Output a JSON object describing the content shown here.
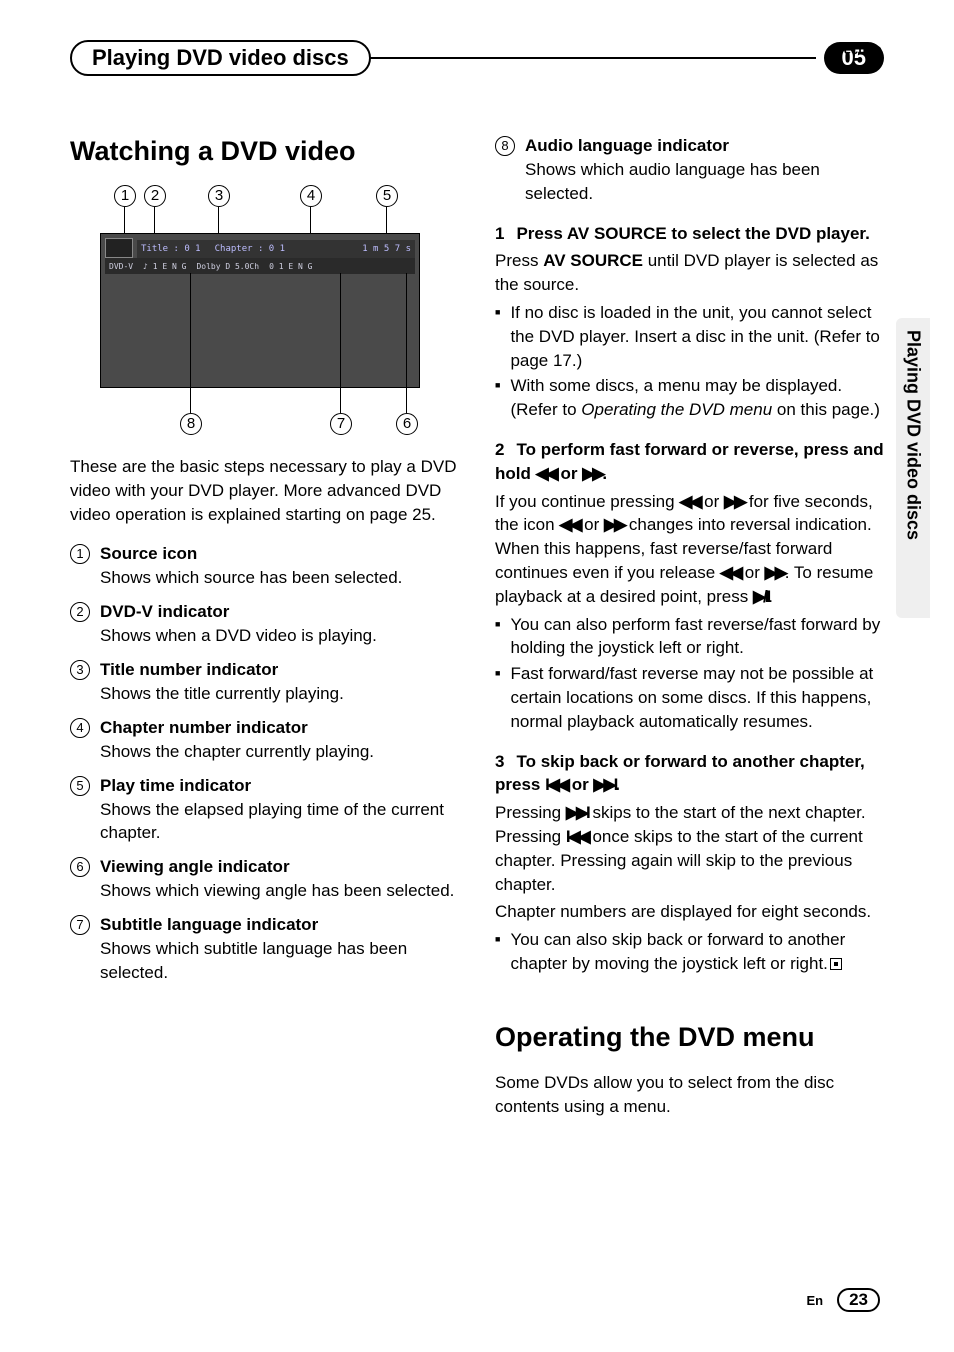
{
  "header": {
    "section_label": "Section",
    "chapter_title": "Playing DVD video discs",
    "chapter_number": "05",
    "side_tab": "Playing DVD video discs"
  },
  "left": {
    "heading": "Watching a DVD video",
    "diagram": {
      "top": [
        "1",
        "2",
        "3",
        "4",
        "5"
      ],
      "bottom": [
        "8",
        "7",
        "6"
      ],
      "bar1": {
        "title": "Title : 0 1",
        "chapter": "Chapter : 0 1",
        "time": "1 m 5 7 s"
      },
      "bar2": {
        "src": "DVD-V",
        "dig": "♪ 1 E N G",
        "dolby": "Dolby D 5.0Ch",
        "ang": "0 1 E N G"
      }
    },
    "intro": "These are the basic steps necessary to play a DVD video with your DVD player. More advanced DVD video operation is explained starting on page 25.",
    "items": [
      {
        "n": "1",
        "title": "Source icon",
        "desc": "Shows which source has been selected."
      },
      {
        "n": "2",
        "title": "DVD-V indicator",
        "desc": "Shows when a DVD video is playing."
      },
      {
        "n": "3",
        "title": "Title number indicator",
        "desc": "Shows the title currently playing."
      },
      {
        "n": "4",
        "title": "Chapter number indicator",
        "desc": "Shows the chapter currently playing."
      },
      {
        "n": "5",
        "title": "Play time indicator",
        "desc": "Shows the elapsed playing time of the current chapter."
      },
      {
        "n": "6",
        "title": "Viewing angle indicator",
        "desc": "Shows which viewing angle has been selected."
      },
      {
        "n": "7",
        "title": "Subtitle language indicator",
        "desc": "Shows which subtitle language has been selected."
      }
    ]
  },
  "right": {
    "cont_item": {
      "n": "8",
      "title": "Audio language indicator",
      "desc": "Shows which audio language has been selected."
    },
    "step1": {
      "head_num": "1",
      "head_text": "Press AV SOURCE to select the DVD player.",
      "line1a": "Press ",
      "line1b": "AV SOURCE",
      "line1c": " until DVD player is selected as the source.",
      "b1": "If no disc is loaded in the unit, you cannot select the DVD player. Insert a disc in the unit. (Refer to page 17.)",
      "b2a": "With some discs, a menu may be displayed. (Refer to ",
      "b2b": "Operating the DVD menu",
      "b2c": " on this page.)"
    },
    "step2": {
      "head_num": "2",
      "head_text_a": "To perform fast forward or reverse, press and hold ",
      "head_text_b": " or ",
      "head_text_c": ".",
      "body_a": "If you continue pressing ",
      "body_b": " or ",
      "body_c": " for five seconds, the icon ",
      "body_d": " or ",
      "body_e": " changes into reversal indication. When this happens, fast reverse/fast forward continues even if you release ",
      "body_f": " or ",
      "body_g": ". To resume playback at a desired point, press ",
      "body_h": ".",
      "b1": "You can also perform fast reverse/fast forward by holding the joystick left or right.",
      "b2": "Fast forward/fast reverse may not be possible at certain locations on some discs. If this happens, normal playback automatically resumes."
    },
    "step3": {
      "head_num": "3",
      "head_text_a": "To skip back or forward to another chapter, press ",
      "head_text_b": " or ",
      "head_text_c": ".",
      "body_a": "Pressing ",
      "body_b": " skips to the start of the next chapter. Pressing ",
      "body_c": " once skips to the start of the current chapter. Pressing again will skip to the previous chapter.",
      "body2": "Chapter numbers are displayed for eight seconds.",
      "b1": "You can also skip back or forward to another chapter by moving the joystick left or right."
    },
    "heading2": "Operating the DVD menu",
    "intro2": "Some DVDs allow you to select from the disc contents using a menu."
  },
  "symbols": {
    "rew": "◀◀",
    "ff": "▶▶",
    "prev": "I◀◀",
    "next": "▶▶I",
    "playpause": "▶/II"
  },
  "footer": {
    "lang": "En",
    "page": "23"
  }
}
